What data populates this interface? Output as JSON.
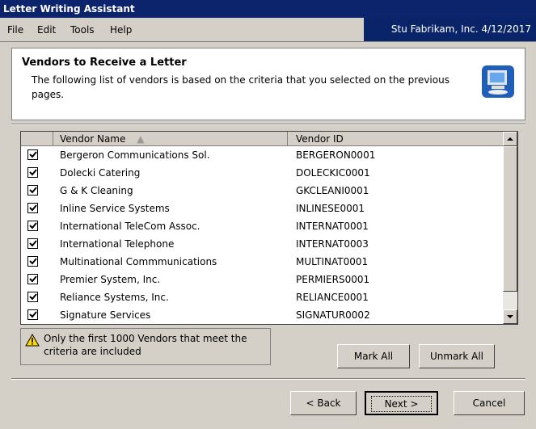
{
  "window": {
    "title": "Letter Writing Assistant"
  },
  "menu": [
    {
      "label": "File"
    },
    {
      "label": "Edit"
    },
    {
      "label": "Tools"
    },
    {
      "label": "Help"
    }
  ],
  "company_date": "Stu  Fabrikam, Inc.  4/12/2017",
  "header": {
    "title": "Vendors to Receive a Letter",
    "description": "The following list of vendors is based on the criteria that you selected on the previous pages."
  },
  "grid": {
    "columns": [
      "Vendor Name",
      "Vendor ID"
    ],
    "rows": [
      {
        "checked": true,
        "name": "Bergeron Communications Sol.",
        "id": "BERGERON0001"
      },
      {
        "checked": true,
        "name": "Dolecki Catering",
        "id": "DOLECKIC0001"
      },
      {
        "checked": true,
        "name": "G & K Cleaning",
        "id": "GKCLEANI0001"
      },
      {
        "checked": true,
        "name": "Inline Service Systems",
        "id": "INLINESE0001"
      },
      {
        "checked": true,
        "name": "International TeleCom Assoc.",
        "id": "INTERNAT0001"
      },
      {
        "checked": true,
        "name": "International Telephone",
        "id": "INTERNAT0003"
      },
      {
        "checked": true,
        "name": "Multinational Commmunications",
        "id": "MULTINAT0001"
      },
      {
        "checked": true,
        "name": "Premier System, Inc.",
        "id": "PERMIERS0001"
      },
      {
        "checked": true,
        "name": "Reliance Systems, Inc.",
        "id": "RELIANCE0001"
      },
      {
        "checked": true,
        "name": "Signature Services",
        "id": "SIGNATUR0002"
      }
    ]
  },
  "note": "Only the first 1000 Vendors that meet the criteria are included",
  "buttons": {
    "mark_all": "Mark All",
    "unmark_all": "Unmark All",
    "back": "< Back",
    "next": "Next >",
    "cancel": "Cancel"
  }
}
